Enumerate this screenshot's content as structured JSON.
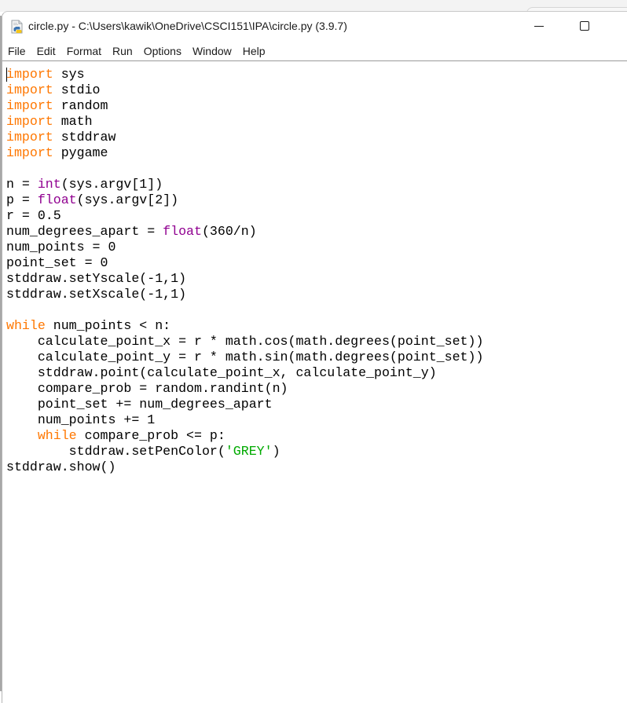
{
  "window": {
    "title": "circle.py - C:\\Users\\kawik\\OneDrive\\CSCI151\\IPA\\circle.py (3.9.7)",
    "app_icon": "python-file-icon",
    "controls": {
      "minimize": "minimize-icon",
      "maximize": "maximize-icon"
    }
  },
  "menubar": {
    "items": [
      "File",
      "Edit",
      "Format",
      "Run",
      "Options",
      "Window",
      "Help"
    ]
  },
  "editor": {
    "filename": "circle.py",
    "language": "python",
    "colors": {
      "keyword": "#ff7700",
      "builtin": "#900090",
      "string": "#00aa00",
      "default": "#000000"
    },
    "lines": [
      [
        {
          "t": "import",
          "c": "kw"
        },
        {
          "t": " sys"
        }
      ],
      [
        {
          "t": "import",
          "c": "kw"
        },
        {
          "t": " stdio"
        }
      ],
      [
        {
          "t": "import",
          "c": "kw"
        },
        {
          "t": " random"
        }
      ],
      [
        {
          "t": "import",
          "c": "kw"
        },
        {
          "t": " math"
        }
      ],
      [
        {
          "t": "import",
          "c": "kw"
        },
        {
          "t": " stddraw"
        }
      ],
      [
        {
          "t": "import",
          "c": "kw"
        },
        {
          "t": " pygame"
        }
      ],
      [],
      [
        {
          "t": "n = "
        },
        {
          "t": "int",
          "c": "bi"
        },
        {
          "t": "(sys.argv[1])"
        }
      ],
      [
        {
          "t": "p = "
        },
        {
          "t": "float",
          "c": "bi"
        },
        {
          "t": "(sys.argv[2])"
        }
      ],
      [
        {
          "t": "r = 0.5"
        }
      ],
      [
        {
          "t": "num_degrees_apart = "
        },
        {
          "t": "float",
          "c": "bi"
        },
        {
          "t": "(360/n)"
        }
      ],
      [
        {
          "t": "num_points = 0"
        }
      ],
      [
        {
          "t": "point_set = 0"
        }
      ],
      [
        {
          "t": "stddraw.setYscale(-1,1)"
        }
      ],
      [
        {
          "t": "stddraw.setXscale(-1,1)"
        }
      ],
      [],
      [
        {
          "t": "while",
          "c": "kw"
        },
        {
          "t": " num_points < n:"
        }
      ],
      [
        {
          "t": "    calculate_point_x = r * math.cos(math.degrees(point_set))"
        }
      ],
      [
        {
          "t": "    calculate_point_y = r * math.sin(math.degrees(point_set))"
        }
      ],
      [
        {
          "t": "    stddraw.point(calculate_point_x, calculate_point_y)"
        }
      ],
      [
        {
          "t": "    compare_prob = random.randint(n)"
        }
      ],
      [
        {
          "t": "    point_set += num_degrees_apart"
        }
      ],
      [
        {
          "t": "    num_points += 1"
        }
      ],
      [
        {
          "t": "    "
        },
        {
          "t": "while",
          "c": "kw"
        },
        {
          "t": " compare_prob <= p:"
        }
      ],
      [
        {
          "t": "        stddraw.setPenColor("
        },
        {
          "t": "'GREY'",
          "c": "str"
        },
        {
          "t": ")"
        }
      ],
      [
        {
          "t": "stddraw.show()"
        }
      ]
    ]
  }
}
